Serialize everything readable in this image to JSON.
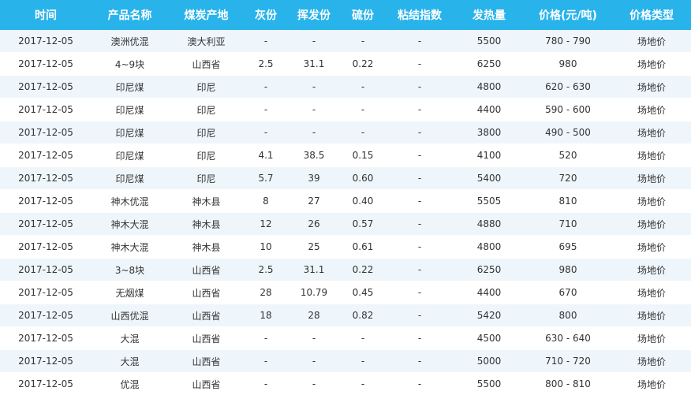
{
  "table": {
    "headers": [
      "时间",
      "产品名称",
      "煤炭产地",
      "灰份",
      "挥发份",
      "硫份",
      "粘结指数",
      "发热量",
      "价格(元/吨)",
      "价格类型"
    ],
    "rows": [
      [
        "2017-12-05",
        "澳洲优混",
        "澳大利亚",
        "-",
        "-",
        "-",
        "-",
        "5500",
        "780 - 790",
        "场地价"
      ],
      [
        "2017-12-05",
        "4~9块",
        "山西省",
        "2.5",
        "31.1",
        "0.22",
        "-",
        "6250",
        "980",
        "场地价"
      ],
      [
        "2017-12-05",
        "印尼煤",
        "印尼",
        "-",
        "-",
        "-",
        "-",
        "4800",
        "620 - 630",
        "场地价"
      ],
      [
        "2017-12-05",
        "印尼煤",
        "印尼",
        "-",
        "-",
        "-",
        "-",
        "4400",
        "590 - 600",
        "场地价"
      ],
      [
        "2017-12-05",
        "印尼煤",
        "印尼",
        "-",
        "-",
        "-",
        "-",
        "3800",
        "490 - 500",
        "场地价"
      ],
      [
        "2017-12-05",
        "印尼煤",
        "印尼",
        "4.1",
        "38.5",
        "0.15",
        "-",
        "4100",
        "520",
        "场地价"
      ],
      [
        "2017-12-05",
        "印尼煤",
        "印尼",
        "5.7",
        "39",
        "0.60",
        "-",
        "5400",
        "720",
        "场地价"
      ],
      [
        "2017-12-05",
        "神木优混",
        "神木县",
        "8",
        "27",
        "0.40",
        "-",
        "5505",
        "810",
        "场地价"
      ],
      [
        "2017-12-05",
        "神木大混",
        "神木县",
        "12",
        "26",
        "0.57",
        "-",
        "4880",
        "710",
        "场地价"
      ],
      [
        "2017-12-05",
        "神木大混",
        "神木县",
        "10",
        "25",
        "0.61",
        "-",
        "4800",
        "695",
        "场地价"
      ],
      [
        "2017-12-05",
        "3~8块",
        "山西省",
        "2.5",
        "31.1",
        "0.22",
        "-",
        "6250",
        "980",
        "场地价"
      ],
      [
        "2017-12-05",
        "无烟煤",
        "山西省",
        "28",
        "10.79",
        "0.45",
        "-",
        "4400",
        "670",
        "场地价"
      ],
      [
        "2017-12-05",
        "山西优混",
        "山西省",
        "18",
        "28",
        "0.82",
        "-",
        "5420",
        "800",
        "场地价"
      ],
      [
        "2017-12-05",
        "大混",
        "山西省",
        "-",
        "-",
        "-",
        "-",
        "4500",
        "630 - 640",
        "场地价"
      ],
      [
        "2017-12-05",
        "大混",
        "山西省",
        "-",
        "-",
        "-",
        "-",
        "5000",
        "710 - 720",
        "场地价"
      ],
      [
        "2017-12-05",
        "优混",
        "山西省",
        "-",
        "-",
        "-",
        "-",
        "5500",
        "800 - 810",
        "场地价"
      ]
    ]
  }
}
